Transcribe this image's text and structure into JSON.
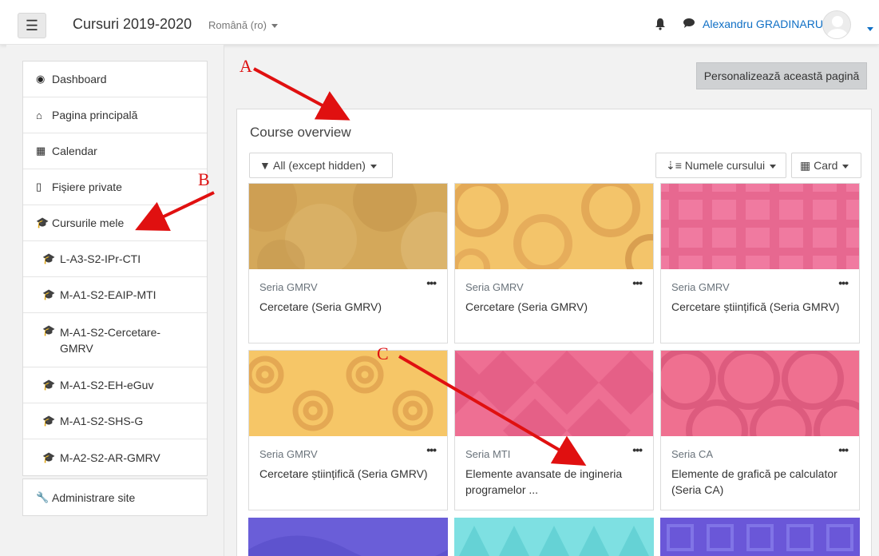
{
  "navbar": {
    "menu_icon": "hamburger-icon",
    "site_name": "Cursuri 2019-2020",
    "language": "Română (ro)",
    "user_name": "Alexandru GRADINARU"
  },
  "sidebar": {
    "items": [
      {
        "label": "Dashboard",
        "icon": "dashboard-icon"
      },
      {
        "label": "Pagina principală",
        "icon": "home-icon"
      },
      {
        "label": "Calendar",
        "icon": "calendar-icon"
      },
      {
        "label": "Fișiere private",
        "icon": "file-icon"
      },
      {
        "label": "Cursurile mele",
        "icon": "graduation-cap-icon"
      },
      {
        "label": "L-A3-S2-IPr-CTI",
        "icon": "graduation-cap-icon"
      },
      {
        "label": "M-A1-S2-EAIP-MTI",
        "icon": "graduation-cap-icon"
      },
      {
        "label": "M-A1-S2-Cercetare-GMRV",
        "icon": "graduation-cap-icon"
      },
      {
        "label": "M-A1-S2-EH-eGuv",
        "icon": "graduation-cap-icon"
      },
      {
        "label": "M-A1-S2-SHS-G",
        "icon": "graduation-cap-icon"
      },
      {
        "label": "M-A2-S2-AR-GMRV",
        "icon": "graduation-cap-icon"
      }
    ],
    "admin": {
      "label": "Administrare site",
      "icon": "wrench-icon"
    }
  },
  "customize_label": "Personalizează această pagină",
  "overview": {
    "title": "Course overview",
    "filter_label": "All (except hidden)",
    "sort_label": "Numele cursului",
    "view_label": "Card",
    "courses": [
      {
        "category": "Seria GMRV",
        "name": "Cercetare (Seria GMRV)",
        "color": "#d4a85a"
      },
      {
        "category": "Seria GMRV",
        "name": "Cercetare (Seria GMRV)",
        "color": "#f3c46a"
      },
      {
        "category": "Seria GMRV",
        "name": "Cercetare științifică (Seria GMRV)",
        "color": "#f07aa0"
      },
      {
        "category": "Seria GMRV",
        "name": "Cercetare științifică (Seria GMRV)",
        "color": "#f6c667"
      },
      {
        "category": "Seria MTI",
        "name": "Elemente avansate de ingineria programelor ...",
        "color": "#ee6f93"
      },
      {
        "category": "Seria CA",
        "name": "Elemente de grafică pe calculator (Seria CA)",
        "color": "#ef7090"
      }
    ],
    "partial_colors": [
      "#6a5ed8",
      "#7ee0e2",
      "#6a57d8"
    ]
  },
  "annotations": {
    "a": "A",
    "b": "B",
    "c": "C"
  }
}
